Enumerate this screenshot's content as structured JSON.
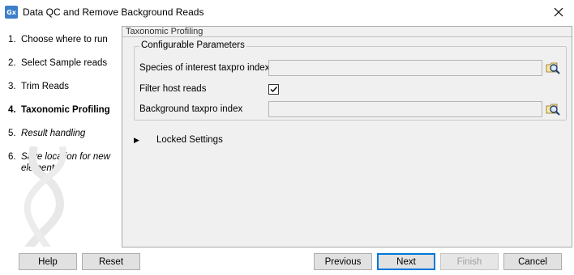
{
  "window": {
    "title": "Data QC and Remove Background Reads",
    "app_icon_text": "Gx"
  },
  "steps": [
    {
      "num": "1.",
      "label": "Choose where to run"
    },
    {
      "num": "2.",
      "label": "Select Sample reads"
    },
    {
      "num": "3.",
      "label": "Trim Reads"
    },
    {
      "num": "4.",
      "label": "Taxonomic Profiling"
    },
    {
      "num": "5.",
      "label": "Result handling"
    },
    {
      "num": "6.",
      "label": "Save location for new elements"
    }
  ],
  "section": {
    "title": "Taxonomic Profiling",
    "group_title": "Configurable Parameters",
    "species_label": "Species of interest taxpro index",
    "species_value": "",
    "filter_label": "Filter host reads",
    "filter_checked": true,
    "background_label": "Background taxpro index",
    "background_value": "",
    "locked_label": "Locked Settings"
  },
  "buttons": {
    "help": "Help",
    "reset": "Reset",
    "previous": "Previous",
    "next": "Next",
    "finish": "Finish",
    "cancel": "Cancel"
  },
  "colors": {
    "accent": "#0078d7",
    "panel_bg": "#f0f0f0",
    "app_icon": "#3d7fc9"
  }
}
